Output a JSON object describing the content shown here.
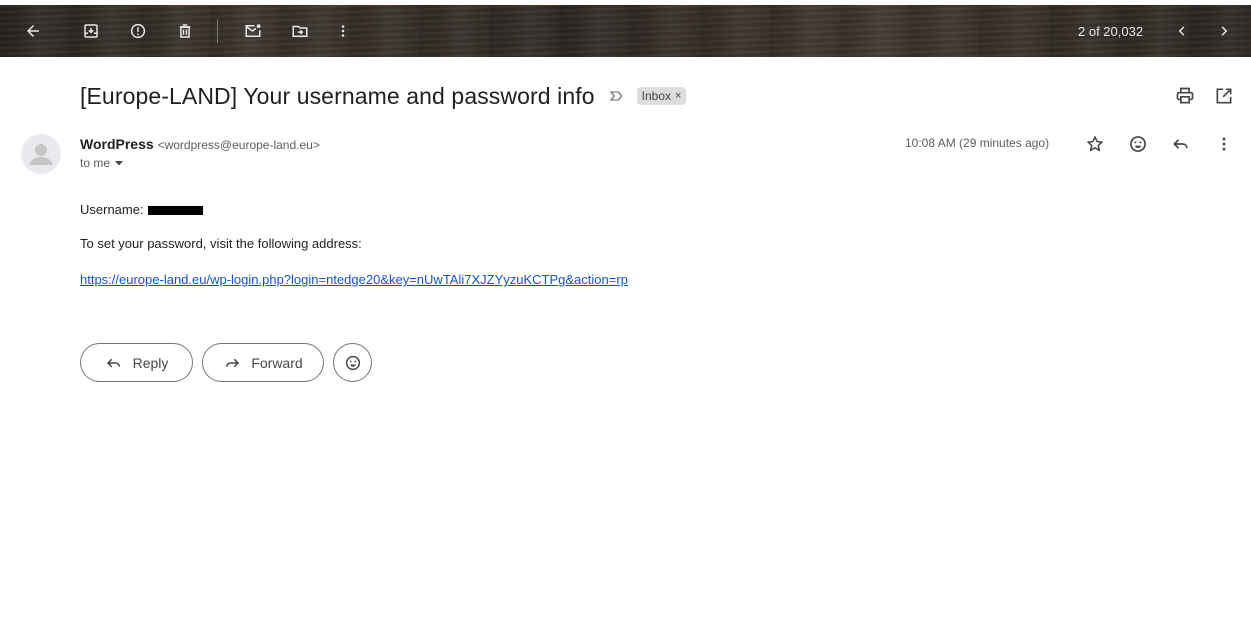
{
  "toolbar": {
    "pager_text": "2 of 20,032",
    "icons": [
      "back-arrow-icon",
      "archive-icon",
      "report-spam-icon",
      "delete-icon",
      "mark-unread-icon",
      "move-to-icon",
      "more-vert-icon",
      "chevron-left-icon",
      "chevron-right-icon"
    ]
  },
  "message": {
    "subject": "[Europe-LAND] Your username and password info",
    "label": "Inbox",
    "label_close": "×",
    "sender_name": "WordPress",
    "sender_email": "<wordpress@europe-land.eu>",
    "recipient": "to me",
    "timestamp": "10:08 AM (29 minutes ago)"
  },
  "body": {
    "username_label": "Username:",
    "password_text": "To set your password, visit the following address:",
    "reset_link": "https://europe-land.eu/wp-login.php?login=ntedge20&key=nUwTAli7XJZYyzuKCTPg&action=rp"
  },
  "actions": {
    "reply": "Reply",
    "forward": "Forward"
  },
  "colors": {
    "link": "#1155cc",
    "toolbar_icon": "#e8e8e8"
  }
}
